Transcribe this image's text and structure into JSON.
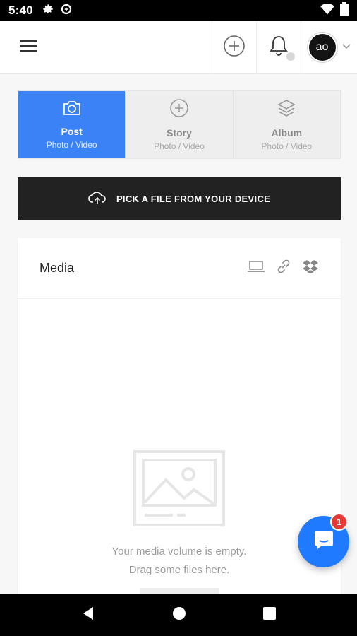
{
  "status_bar": {
    "time": "5:40",
    "icons": [
      "gear-icon",
      "data-saver-icon",
      "wifi-icon",
      "battery-icon"
    ]
  },
  "appbar": {
    "menu_icon": "hamburger-menu-icon",
    "add_icon": "plus-circle-icon",
    "notifications_icon": "bell-icon",
    "avatar_text": "ao",
    "dropdown_icon": "chevron-down-icon"
  },
  "tabs": [
    {
      "title": "Post",
      "subtitle": "Photo / Video",
      "icon": "camera-icon",
      "active": true
    },
    {
      "title": "Story",
      "subtitle": "Photo / Video",
      "icon": "plus-circle-icon",
      "active": false
    },
    {
      "title": "Album",
      "subtitle": "Photo / Video",
      "icon": "layers-icon",
      "active": false
    }
  ],
  "pick_button": {
    "label": "PICK A FILE FROM YOUR DEVICE",
    "icon": "cloud-upload-icon"
  },
  "media": {
    "title": "Media",
    "actions": [
      "laptop-icon",
      "link-icon",
      "dropbox-icon"
    ],
    "empty_line1": "Your media volume is empty.",
    "empty_line2": "Drag some files here."
  },
  "chat": {
    "badge_count": "1",
    "icon": "chat-bubble-icon"
  },
  "nav": [
    "back-icon",
    "home-icon",
    "recents-icon"
  ],
  "colors": {
    "accent": "#3b82f6",
    "dark_button": "#222222",
    "chat": "#1f7aff",
    "badge": "#e53935"
  }
}
